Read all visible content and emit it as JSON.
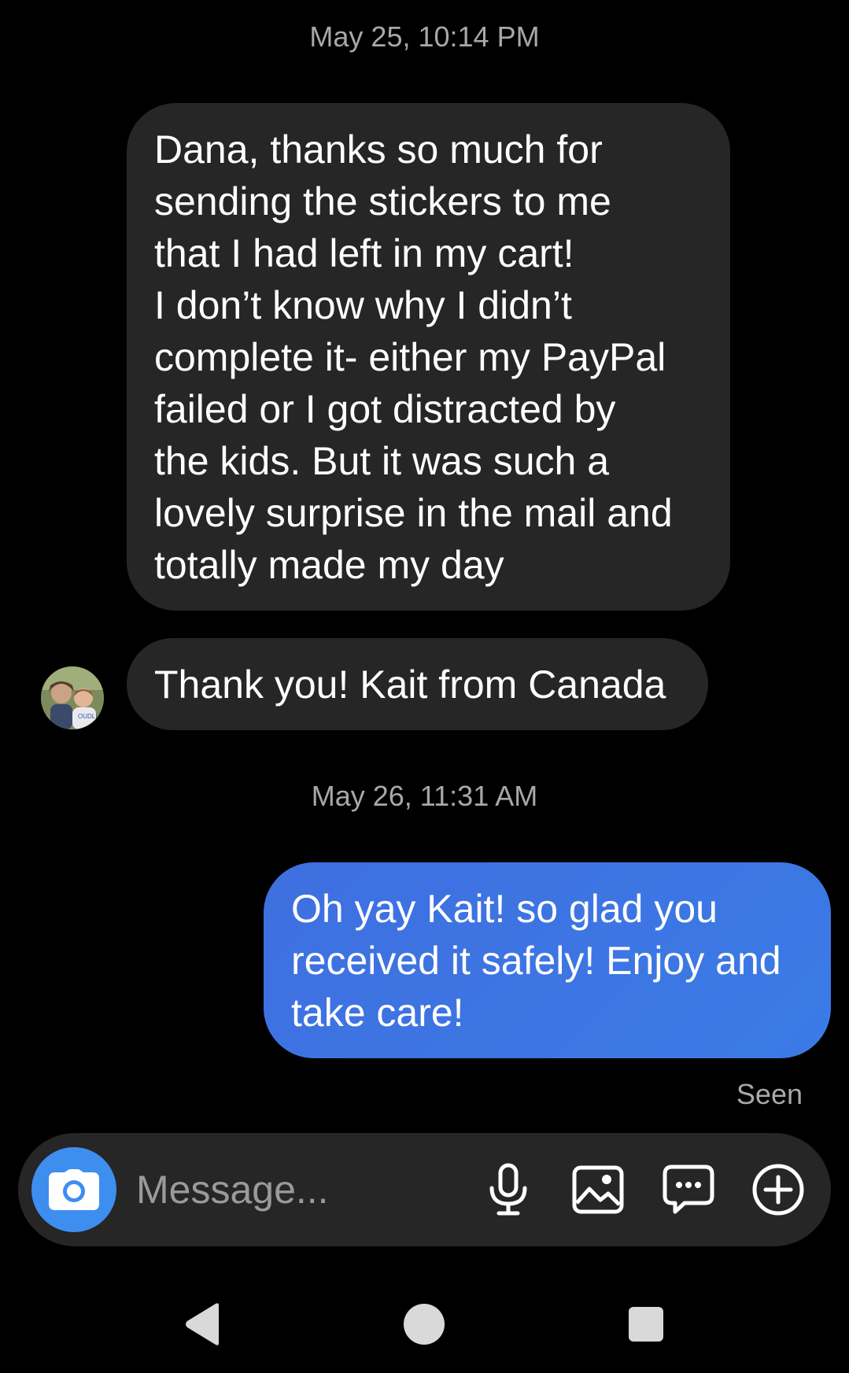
{
  "conversation": {
    "groups": [
      {
        "timestamp": "May 25, 10:14 PM"
      },
      {
        "timestamp": "May 26, 11:31 AM"
      }
    ],
    "messages": [
      {
        "direction": "received",
        "text": "Dana, thanks so much for\nsending the stickers to me\nthat I had left in my cart!\nI don’t know why I didn’t\ncomplete it- either my PayPal\nfailed or I got distracted by\nthe kids. But it was such a\nlovely surprise in the mail and\ntotally made my day"
      },
      {
        "direction": "received",
        "text": "Thank you! Kait from Canada"
      },
      {
        "direction": "sent",
        "text": "Oh yay Kait! so glad you\nreceived it safely! Enjoy and\ntake care!"
      }
    ],
    "seen_label": "Seen"
  },
  "composer": {
    "placeholder": "Message...",
    "icons": {
      "camera": "camera-icon",
      "mic": "microphone-icon",
      "gallery": "image-icon",
      "sticker": "chat-bubble-icon",
      "more": "plus-circle-icon"
    }
  },
  "navigation": {
    "icons": [
      "back-triangle-icon",
      "home-circle-icon",
      "recents-square-icon"
    ]
  },
  "colors": {
    "background": "#000000",
    "received_bubble": "#262626",
    "sent_bubble": "#3b7be6",
    "camera_button": "#3e8ef0",
    "secondary_text": "#a8a8a8"
  }
}
